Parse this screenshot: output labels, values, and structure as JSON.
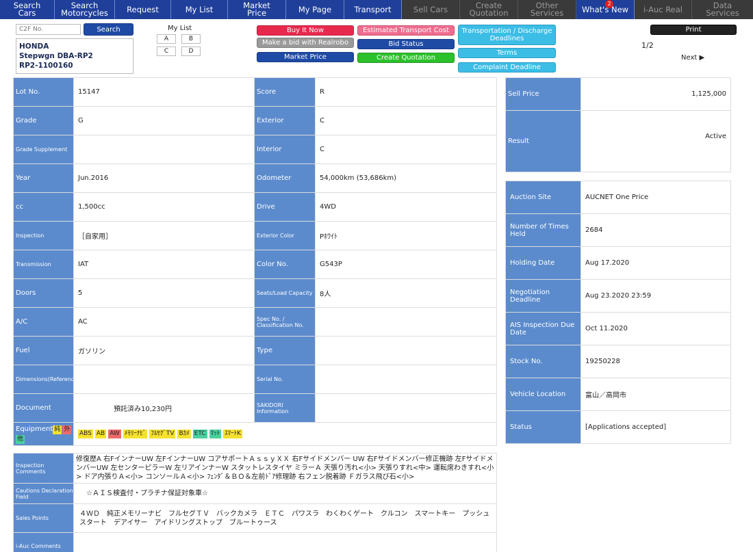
{
  "nav": [
    {
      "label": "Search\nCars",
      "state": "active"
    },
    {
      "label": "Search\nMotorcycles",
      "state": "normal"
    },
    {
      "label": "Request",
      "state": "normal"
    },
    {
      "label": "My List",
      "state": "normal"
    },
    {
      "label": "Market\nPrice",
      "state": "normal"
    },
    {
      "label": "My Page",
      "state": "normal"
    },
    {
      "label": "Transport",
      "state": "normal"
    },
    {
      "label": "Sell Cars",
      "state": "disabled"
    },
    {
      "label": "Create\nQuotation",
      "state": "disabled"
    },
    {
      "label": "Other\nServices",
      "state": "disabled"
    },
    {
      "label": "What's New",
      "state": "normal",
      "badge": "2"
    },
    {
      "label": "i-Auc Real",
      "state": "disabled"
    },
    {
      "label": "Data\nServices",
      "state": "disabled"
    }
  ],
  "toolbar": {
    "search_placeholder": "C2F No.",
    "search_label": "Search",
    "mylist_title": "My List",
    "mylist": [
      "A",
      "B",
      "C",
      "D"
    ],
    "buy_it_now": "Buy It Now",
    "realrobo": "Make a bid with Realrobo",
    "market_price": "Market Price",
    "estimated_transport": "Estimated Transport Cost",
    "bid_status": "Bid Status",
    "create_quotation": "Create Quotation",
    "transport_deadlines": "Transportation / Discharge\nDeadlines",
    "terms": "Terms",
    "complaint": "Complaint Deadline",
    "print": "Print",
    "page_indicator": "1/2",
    "next": "Next"
  },
  "vehicle": {
    "make": "HONDA",
    "model": "Stepwgn DBA-RP2",
    "code": "RP2-1100160"
  },
  "specs_left": [
    {
      "label": "Lot No.",
      "value": "15147"
    },
    {
      "label": "Grade",
      "value": "G"
    },
    {
      "label": "Grade Supplement",
      "value": "",
      "small": true
    },
    {
      "label": "Year",
      "value": "Jun.2016"
    },
    {
      "label": "cc",
      "value": "1,500cc"
    },
    {
      "label": "Inspection",
      "value": "［自家用］",
      "small": true
    },
    {
      "label": "Transmission",
      "value": "IAT",
      "small": true
    },
    {
      "label": "Doors",
      "value": "5"
    },
    {
      "label": "A/C",
      "value": "AC"
    },
    {
      "label": "Fuel",
      "value": "ガソリン"
    },
    {
      "label": "Dimensions(Reference)",
      "value": "",
      "small": true
    },
    {
      "label": "Document",
      "value": "預託済み10,230円"
    }
  ],
  "specs_right": [
    {
      "label": "Score",
      "value": "R"
    },
    {
      "label": "Exterior",
      "value": "C"
    },
    {
      "label": "Interior",
      "value": "C"
    },
    {
      "label": "Odometer",
      "value": "54,000km (53,686km)"
    },
    {
      "label": "Drive",
      "value": "4WD"
    },
    {
      "label": "Exterior Color",
      "value": "Pﾎﾜｲﾄ",
      "small": true
    },
    {
      "label": "Color No.",
      "value": "G543P"
    },
    {
      "label": "Seats/Load Capacity",
      "value": "8人",
      "small": true
    },
    {
      "label": "Spec No. / Classification No.",
      "value": "",
      "small": true
    },
    {
      "label": "Type",
      "value": ""
    },
    {
      "label": "Serial No.",
      "value": "",
      "small": true
    },
    {
      "label": "SAKIDORI Information",
      "value": "",
      "small": true
    }
  ],
  "equipment": {
    "label": "Equipment",
    "label_tags": [
      {
        "text": "純",
        "color": "y"
      },
      {
        "text": "外",
        "color": "r"
      },
      {
        "text": "他",
        "color": "g"
      }
    ],
    "tags": [
      {
        "text": "ABS",
        "color": "y"
      },
      {
        "text": "AB",
        "color": "y"
      },
      {
        "text": "AW",
        "color": "r"
      },
      {
        "text": "ﾒﾓﾘｰﾅﾋﾞ",
        "color": "y"
      },
      {
        "text": "ﾌﾙｾｸﾞTV",
        "color": "y"
      },
      {
        "text": "Bｶﾒ",
        "color": "y"
      },
      {
        "text": "ETC",
        "color": "g"
      },
      {
        "text": "ﾏｯﾄ",
        "color": "g"
      },
      {
        "text": "ｽﾏｰﾄK",
        "color": "y"
      }
    ]
  },
  "price_panel": [
    {
      "label": "Sell Price",
      "value": "1,125,000"
    },
    {
      "label": "Result",
      "value": "Active"
    }
  ],
  "auction_panel": [
    {
      "label": "Auction Site",
      "value": "AUCNET One Price"
    },
    {
      "label": "Number of Times Held",
      "value": "2684"
    },
    {
      "label": "Holding Date",
      "value": "Aug 17.2020"
    },
    {
      "label": "Negotiation Deadline",
      "value": "Aug 23.2020 23:59"
    },
    {
      "label": "AIS Inspection Due Date",
      "value": "Oct 11.2020"
    },
    {
      "label": "Stock No.",
      "value": "19250228"
    },
    {
      "label": "Vehicle Location",
      "value": "富山／高岡市"
    },
    {
      "label": "Status",
      "value": "[Applications accepted]"
    }
  ],
  "comments": [
    {
      "label": "Inspection Comments",
      "value": "修復歴A 右FインナーUW 左FインナーUW コアサポートＡｓｓｙＸＸ 右Fサイドメンバー UW 右Fサイドメンバー修正機跡 左FサイドメンバーUW 左センターピラーW 左リアインナーW スタットレスタイヤ ミラーＡ 天張り汚れ<小> 天張りすれ<中> 運転席わきすれ<小> ドア内張りＡ<小> コンソールＡ<小> ﾌｪﾝﾀﾞ＆ＢＯ＆左前ﾄﾞｱ修理跡 右フェン脱着跡 Ｆガラス飛び石<小>"
    },
    {
      "label": "Cautions Declaration Field",
      "value": "☆ＡＩＳ検査付・プラチナ保証対象車☆"
    },
    {
      "label": "Sales Points",
      "value": "４ＷＤ　純正メモリーナビ　フルセグＴＶ　バックカメラ　ＥＴＣ　パワスラ　わくわくゲート　クルコン　スマートキー　プッシュスタート　デアイサー　アイドリングストップ　ブルートゥース"
    },
    {
      "label": "i-Auc Comments",
      "value": ""
    }
  ]
}
